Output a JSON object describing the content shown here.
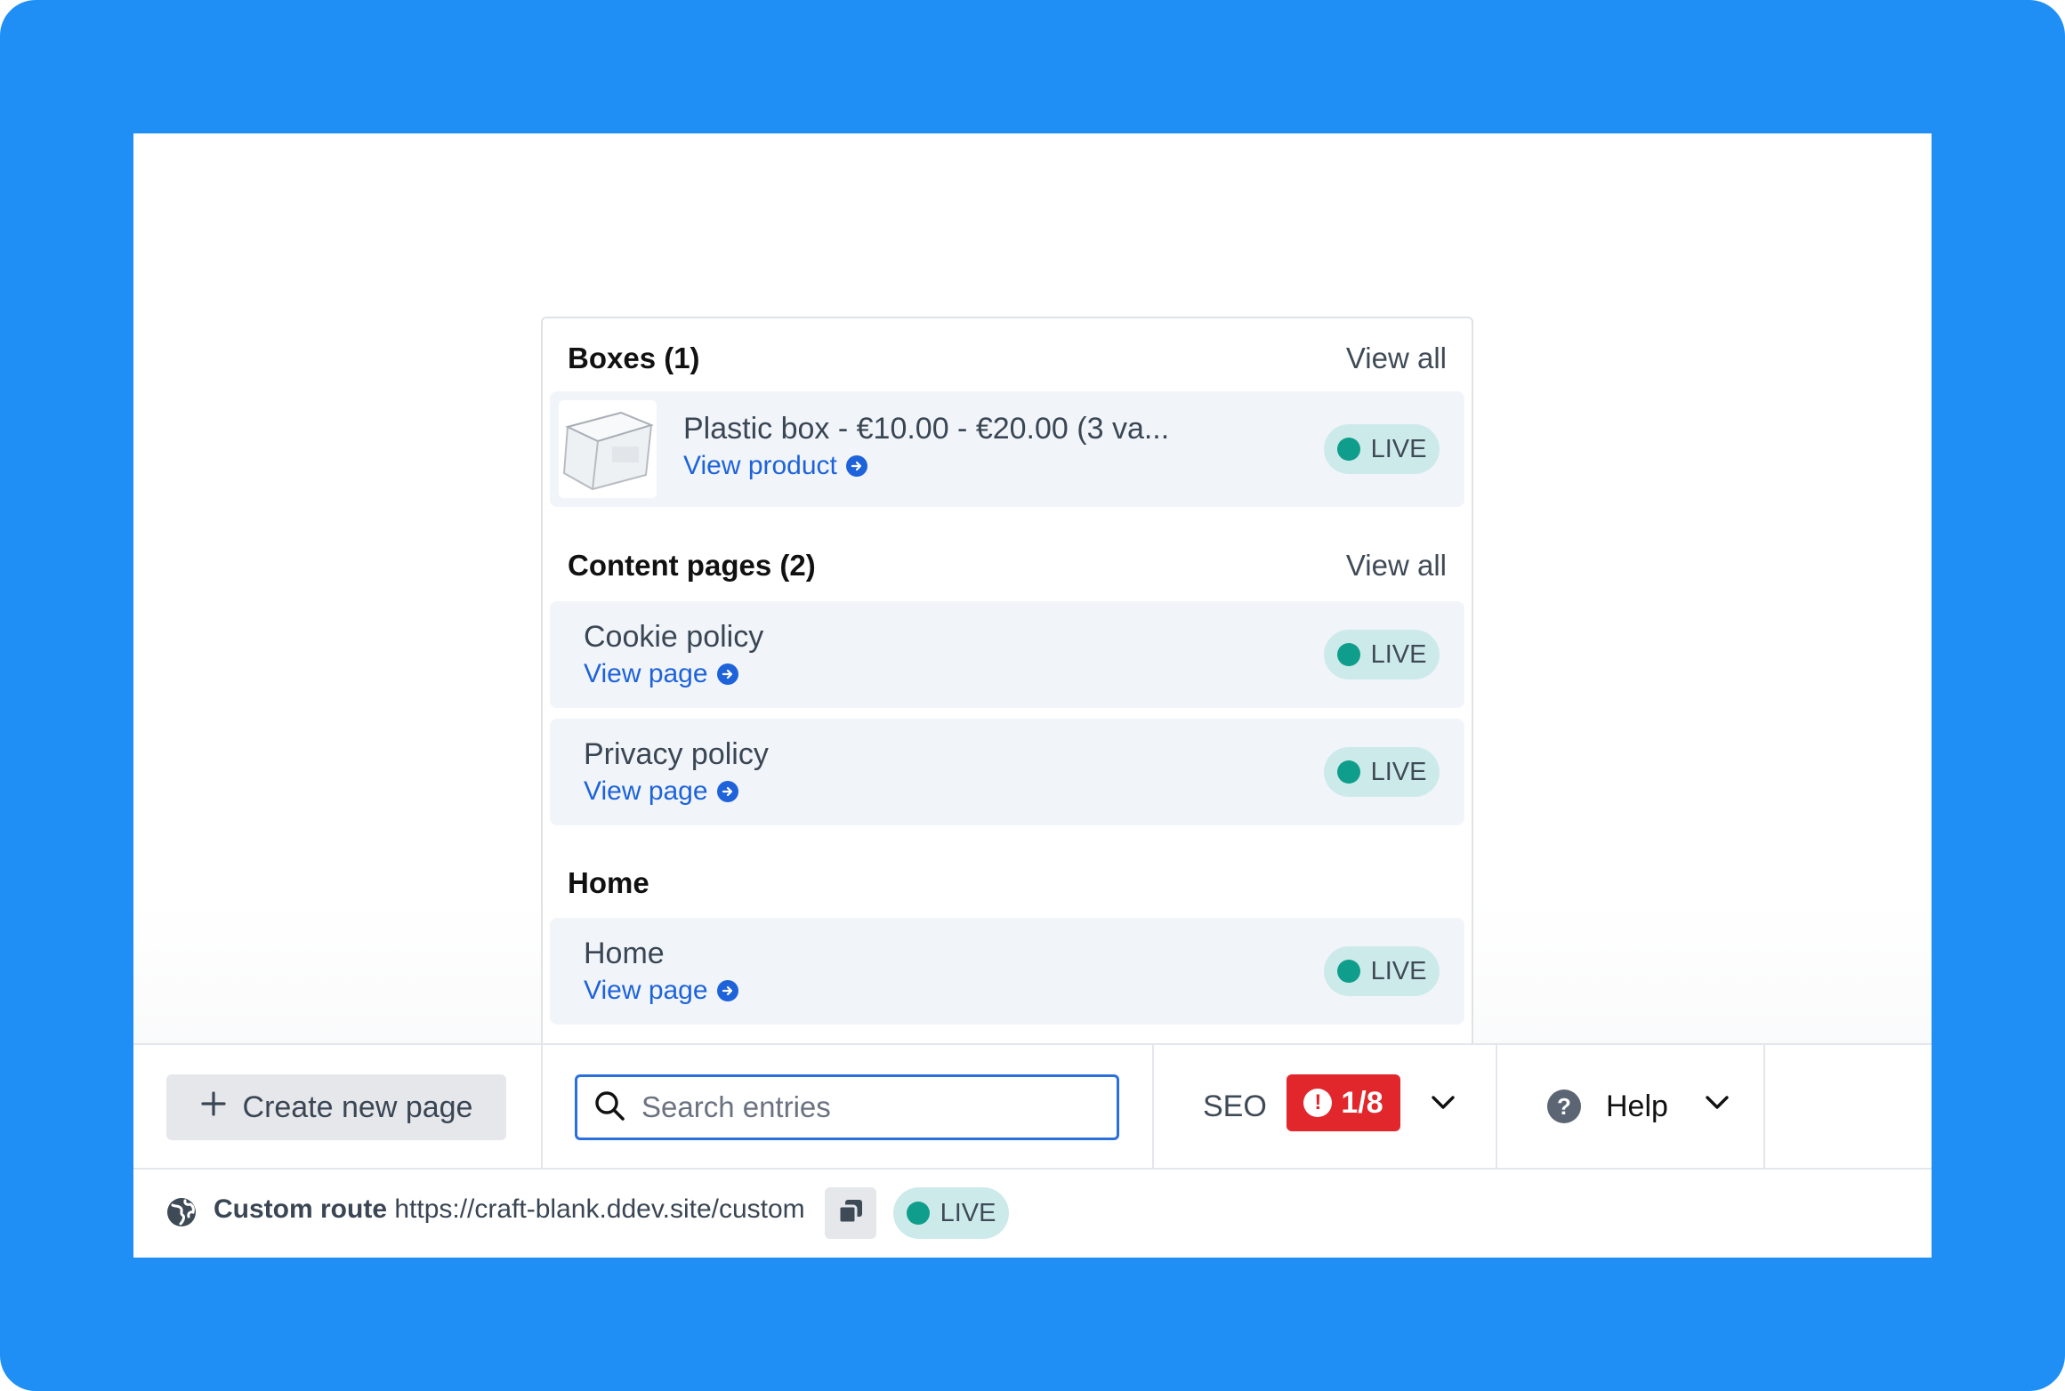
{
  "boxes": {
    "title": "Boxes (1)",
    "view_all": "View all",
    "items": [
      {
        "title": "Plastic box - €10.00 - €20.00 (3 va...",
        "link": "View product",
        "status": "LIVE"
      }
    ]
  },
  "content_pages": {
    "title": "Content pages (2)",
    "view_all": "View all",
    "items": [
      {
        "title": "Cookie policy",
        "link": "View page",
        "status": "LIVE"
      },
      {
        "title": "Privacy policy",
        "link": "View page",
        "status": "LIVE"
      }
    ]
  },
  "home": {
    "title": "Home",
    "items": [
      {
        "title": "Home",
        "link": "View page",
        "status": "LIVE"
      }
    ]
  },
  "toolbar": {
    "create_label": "Create new page",
    "search_placeholder": "Search entries",
    "search_value": "",
    "seo_label": "SEO",
    "seo_score": "1/8",
    "help_label": "Help"
  },
  "status_bar": {
    "route_label": "Custom route",
    "route_url": "https://craft-blank.ddev.site/custom",
    "status": "LIVE"
  },
  "colors": {
    "background": "#1f8ff5",
    "link": "#1e63d9",
    "live_dot": "#0f9e8b",
    "live_badge": "#cdeaea",
    "seo_badge": "#e1262c",
    "search_border": "#2a6fdb"
  },
  "icons": [
    "plus-icon",
    "search-icon",
    "exclamation-icon",
    "chevron-down-icon",
    "help-icon",
    "globe-icon",
    "copy-icon",
    "arrow-right-circle-icon"
  ]
}
